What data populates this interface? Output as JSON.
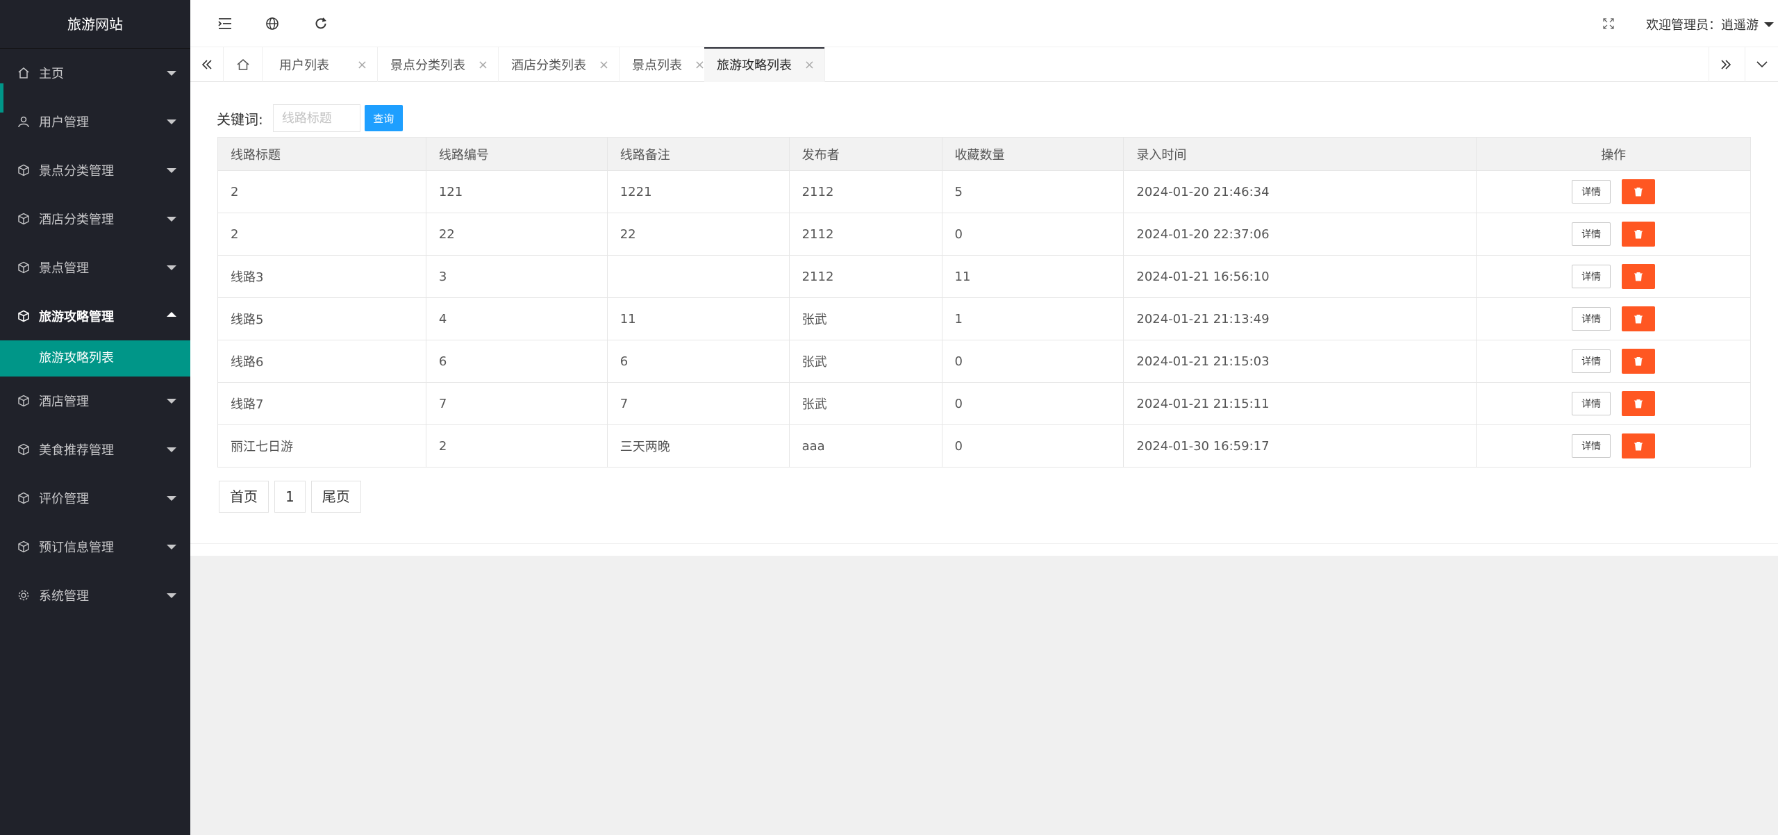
{
  "app": {
    "title": "旅游网站"
  },
  "sidebar": {
    "items": [
      {
        "label": "主页",
        "icon": "home-icon"
      },
      {
        "label": "用户管理",
        "icon": "user-icon"
      },
      {
        "label": "景点分类管理",
        "icon": "cube-icon"
      },
      {
        "label": "酒店分类管理",
        "icon": "cube-icon"
      },
      {
        "label": "景点管理",
        "icon": "cube-icon"
      },
      {
        "label": "旅游攻略管理",
        "icon": "cube-icon",
        "expanded": true,
        "children": [
          {
            "label": "旅游攻略列表",
            "active": true
          }
        ]
      },
      {
        "label": "酒店管理",
        "icon": "cube-icon"
      },
      {
        "label": "美食推荐管理",
        "icon": "cube-icon"
      },
      {
        "label": "评价管理",
        "icon": "cube-icon"
      },
      {
        "label": "预订信息管理",
        "icon": "cube-icon"
      },
      {
        "label": "系统管理",
        "icon": "gear-icon"
      }
    ]
  },
  "header": {
    "welcome": "欢迎管理员：逍遥游",
    "icons": [
      "menu-fold-icon",
      "globe-icon",
      "refresh-icon",
      "fullscreen-icon"
    ]
  },
  "tabs": {
    "items": [
      {
        "label": "用户列表"
      },
      {
        "label": "景点分类列表"
      },
      {
        "label": "酒店分类列表"
      },
      {
        "label": "景点列表"
      },
      {
        "label": "旅游攻略列表",
        "active": true
      }
    ],
    "close_glyph": "×"
  },
  "search": {
    "label": "关键词:",
    "placeholder": "线路标题",
    "value": "",
    "button": "查询"
  },
  "table": {
    "headers": [
      "线路标题",
      "线路编号",
      "线路备注",
      "发布者",
      "收藏数量",
      "录入时间",
      "操作"
    ],
    "rows": [
      [
        "2",
        "121",
        "1221",
        "2112",
        "5",
        "2024-01-20 21:46:34"
      ],
      [
        "2",
        "22",
        "22",
        "2112",
        "0",
        "2024-01-20 22:37:06"
      ],
      [
        "线路3",
        "3",
        "",
        "2112",
        "11",
        "2024-01-21 16:56:10"
      ],
      [
        "线路5",
        "4",
        "11",
        "张武",
        "1",
        "2024-01-21 21:13:49"
      ],
      [
        "线路6",
        "6",
        "6",
        "张武",
        "0",
        "2024-01-21 21:15:03"
      ],
      [
        "线路7",
        "7",
        "7",
        "张武",
        "0",
        "2024-01-21 21:15:11"
      ],
      [
        "丽江七日游",
        "2",
        "三天两晚",
        "aaa",
        "0",
        "2024-01-30 16:59:17"
      ]
    ],
    "detail_label": "详情",
    "delete_icon": "trash-icon"
  },
  "pager": {
    "first": "首页",
    "current": "1",
    "last": "尾页"
  },
  "colors": {
    "sidebar_bg": "#20222a",
    "accent": "#009688",
    "primary_btn": "#1e9fff",
    "danger_btn": "#ff5722"
  }
}
